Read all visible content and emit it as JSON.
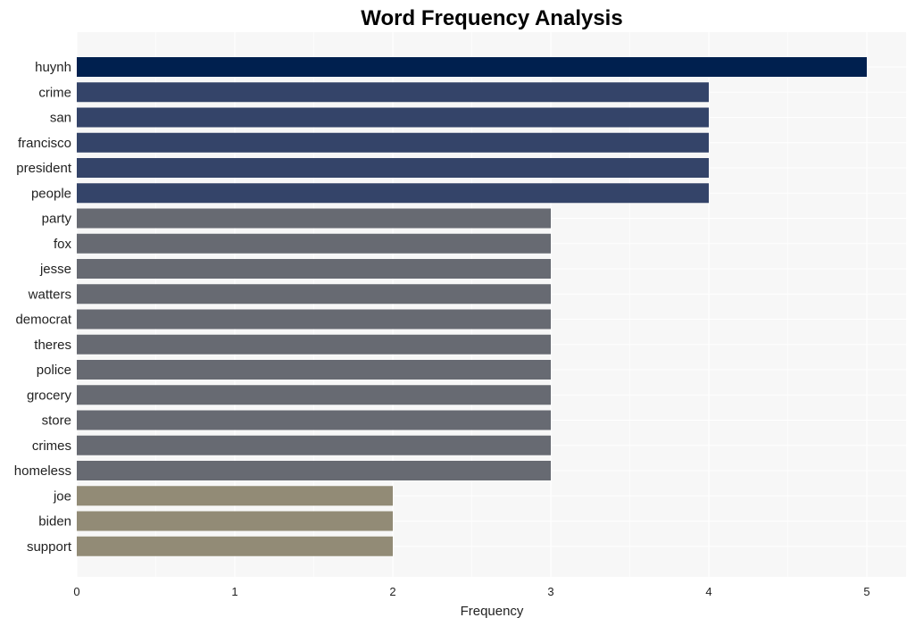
{
  "chart_data": {
    "type": "bar",
    "orientation": "horizontal",
    "title": "Word Frequency Analysis",
    "xlabel": "Frequency",
    "ylabel": "",
    "xlim": [
      0,
      5.25
    ],
    "xticks": [
      0,
      1,
      2,
      3,
      4,
      5
    ],
    "grid": true,
    "categories": [
      "huynh",
      "crime",
      "san",
      "francisco",
      "president",
      "people",
      "party",
      "fox",
      "jesse",
      "watters",
      "democrat",
      "theres",
      "police",
      "grocery",
      "store",
      "crimes",
      "homeless",
      "joe",
      "biden",
      "support"
    ],
    "values": [
      5,
      4,
      4,
      4,
      4,
      4,
      3,
      3,
      3,
      3,
      3,
      3,
      3,
      3,
      3,
      3,
      3,
      2,
      2,
      2
    ],
    "colors_by_value": {
      "5": "#00204f",
      "4": "#344469",
      "3": "#676a72",
      "2": "#928b76"
    },
    "background": "#f7f7f7"
  }
}
